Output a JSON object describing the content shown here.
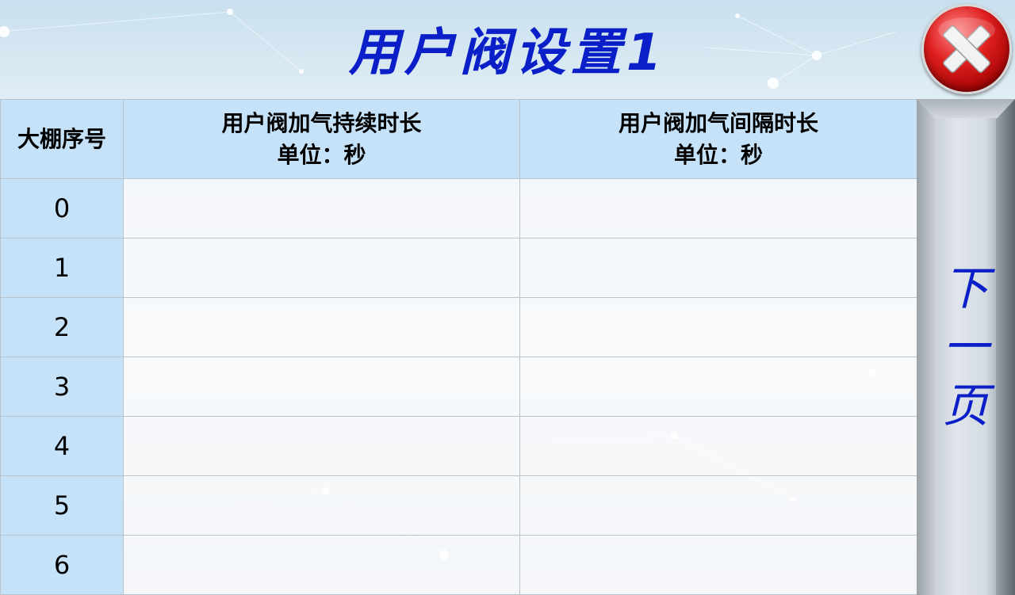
{
  "header": {
    "title": "用户阀设置1",
    "close_icon": "close-icon"
  },
  "table": {
    "columns": {
      "index": "大棚序号",
      "duration": {
        "label": "用户阀加气持续时长",
        "unit": "单位：秒"
      },
      "interval": {
        "label": "用户阀加气间隔时长",
        "unit": "单位：秒"
      }
    },
    "rows": [
      {
        "index": "0",
        "duration": "",
        "interval": ""
      },
      {
        "index": "1",
        "duration": "",
        "interval": ""
      },
      {
        "index": "2",
        "duration": "",
        "interval": ""
      },
      {
        "index": "3",
        "duration": "",
        "interval": ""
      },
      {
        "index": "4",
        "duration": "",
        "interval": ""
      },
      {
        "index": "5",
        "duration": "",
        "interval": ""
      },
      {
        "index": "6",
        "duration": "",
        "interval": ""
      }
    ]
  },
  "nav": {
    "next_page_chars": [
      "下",
      "一",
      "页"
    ]
  },
  "colors": {
    "title": "#0b1fc8",
    "header_cell": "#c6e2f9",
    "close_red": "#e01f1f"
  }
}
